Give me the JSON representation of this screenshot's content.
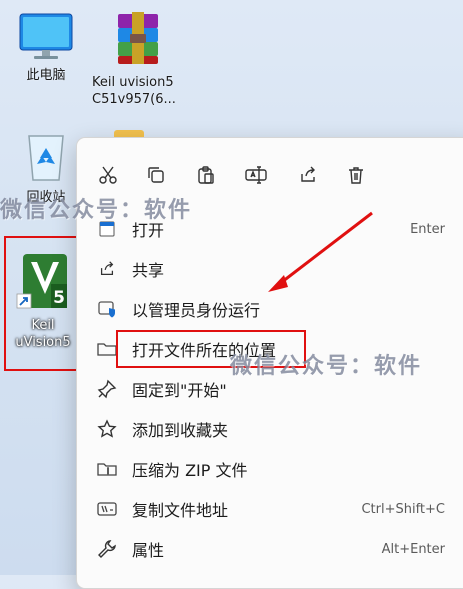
{
  "desktop": {
    "icons": [
      {
        "label": "此电脑"
      },
      {
        "label1": "Keil uvision5",
        "label2": "C51v957(6..."
      },
      {
        "label": "回收站"
      },
      {
        "label1": "Keil",
        "label2": "uVision5",
        "badge": "5"
      }
    ]
  },
  "watermark": "微信公众号：软件",
  "context_menu": {
    "toolbar": [
      "cut-icon",
      "copy-icon",
      "paste-icon",
      "rename-icon",
      "share-icon",
      "delete-icon"
    ],
    "items": [
      {
        "label": "打开",
        "shortcut": "Enter",
        "icon": "open-icon"
      },
      {
        "label": "共享",
        "shortcut": "",
        "icon": "share-icon"
      },
      {
        "label": "以管理员身份运行",
        "shortcut": "",
        "icon": "shield-icon"
      },
      {
        "label": "打开文件所在的位置",
        "shortcut": "",
        "icon": "folder-icon"
      },
      {
        "label": "固定到\"开始\"",
        "shortcut": "",
        "icon": "pin-icon"
      },
      {
        "label": "添加到收藏夹",
        "shortcut": "",
        "icon": "star-icon"
      },
      {
        "label": "压缩为 ZIP 文件",
        "shortcut": "",
        "icon": "zip-icon"
      },
      {
        "label": "复制文件地址",
        "shortcut": "Ctrl+Shift+C",
        "icon": "copy-path-icon"
      },
      {
        "label": "属性",
        "shortcut": "Alt+Enter",
        "icon": "wrench-icon"
      }
    ]
  },
  "colors": {
    "highlight": "#e01010",
    "accent": "#1a6fd0",
    "keil_green": "#2e7d32"
  }
}
